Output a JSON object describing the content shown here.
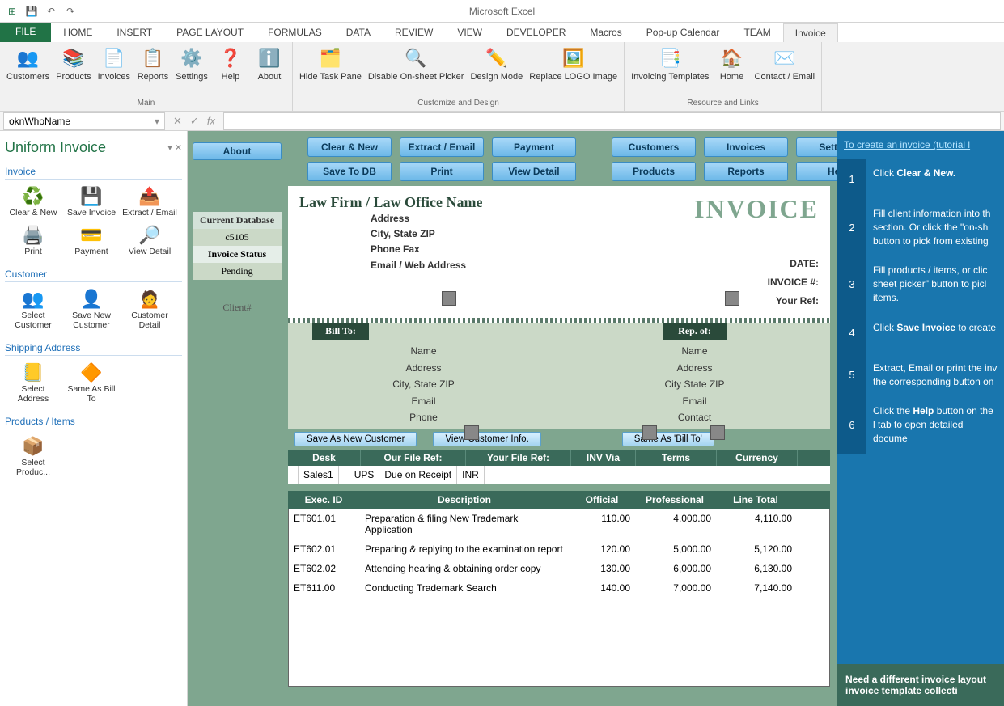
{
  "app_title": "Microsoft Excel",
  "tabs": [
    "FILE",
    "HOME",
    "INSERT",
    "PAGE LAYOUT",
    "FORMULAS",
    "DATA",
    "REVIEW",
    "VIEW",
    "DEVELOPER",
    "Macros",
    "Pop-up Calendar",
    "TEAM",
    "Invoice"
  ],
  "ribbon": {
    "groups": [
      {
        "label": "Main",
        "items": [
          "Customers",
          "Products",
          "Invoices",
          "Reports",
          "Settings",
          "Help",
          "About"
        ]
      },
      {
        "label": "Customize and Design",
        "items": [
          "Hide Task Pane",
          "Disable On-sheet Picker",
          "Design Mode",
          "Replace LOGO Image"
        ]
      },
      {
        "label": "Resource and Links",
        "items": [
          "Invoicing Templates",
          "Home",
          "Contact / Email"
        ]
      }
    ]
  },
  "namebox": "oknWhoName",
  "taskpane": {
    "title": "Uniform Invoice",
    "sections": {
      "invoice": {
        "h": "Invoice",
        "items": [
          "Clear & New",
          "Save Invoice",
          "Extract / Email",
          "Print",
          "Payment",
          "View Detail"
        ]
      },
      "customer": {
        "h": "Customer",
        "items": [
          "Select Customer",
          "Save New Customer",
          "Customer Detail"
        ]
      },
      "shipping": {
        "h": "Shipping Address",
        "items": [
          "Select Address",
          "Same As Bill To"
        ]
      },
      "products": {
        "h": "Products / Items",
        "items": [
          "Select Produc..."
        ]
      }
    }
  },
  "topbuttons": {
    "about": "About",
    "col1": [
      "Clear & New",
      "Save To DB"
    ],
    "col2": [
      "Extract / Email",
      "Print"
    ],
    "col3": [
      "Payment",
      "View Detail"
    ],
    "col4": [
      "Customers",
      "Products"
    ],
    "col5": [
      "Invoices",
      "Reports"
    ],
    "col6": [
      "Settings",
      "Help"
    ]
  },
  "leftlabels": {
    "db": "Current Database",
    "dbval": "c5105",
    "status": "Invoice Status",
    "statusval": "Pending",
    "client": "Client#"
  },
  "header": {
    "firm": "Law Firm / Law Office Name",
    "addr": [
      "Address",
      "City, State ZIP",
      "Phone Fax",
      "Email / Web Address"
    ],
    "invoice": "INVOICE",
    "right": [
      "DATE:",
      "INVOICE #:",
      "Your Ref:"
    ]
  },
  "bill": {
    "h1": "Bill To:",
    "h2": "Rep. of:",
    "left": [
      "Name",
      "Address",
      "City, State ZIP",
      "Email",
      "Phone"
    ],
    "right": [
      "Name",
      "Address",
      "City State ZIP",
      "Email",
      "Contact"
    ]
  },
  "actions": [
    "Save As New Customer",
    "View Customer Info.",
    "Same As 'Bill To'"
  ],
  "detail_hdr": [
    "Desk",
    "Our File Ref:",
    "Your File Ref:",
    "INV Via",
    "Terms",
    "Currency"
  ],
  "detail_vals": [
    "",
    "Sales1",
    "",
    "UPS",
    "Due on Receipt",
    "INR"
  ],
  "items_hdr": [
    "Exec. ID",
    "Description",
    "Official",
    "Professional",
    "Line Total"
  ],
  "items": [
    {
      "id": "ET601.01",
      "desc": "Preparation & filing New Trademark Application",
      "off": "110.00",
      "prof": "4,000.00",
      "tot": "4,110.00"
    },
    {
      "id": "ET602.01",
      "desc": "Preparing & replying to the examination report",
      "off": "120.00",
      "prof": "5,000.00",
      "tot": "5,120.00"
    },
    {
      "id": "ET602.02",
      "desc": "Attending hearing & obtaining order copy",
      "off": "130.00",
      "prof": "6,000.00",
      "tot": "6,130.00"
    },
    {
      "id": "ET611.00",
      "desc": "Conducting Trademark Search",
      "off": "140.00",
      "prof": "7,000.00",
      "tot": "7,140.00"
    }
  ],
  "tutorial": {
    "link": "To create an invoice (tutorial l",
    "steps": [
      {
        "n": "1",
        "t": "Click <b>Clear & New.</b>"
      },
      {
        "n": "2",
        "t": "Fill client information into th section. Or click the \"on-sh button to pick from existing"
      },
      {
        "n": "3",
        "t": "Fill products / items, or clic sheet picker\" button to picl items."
      },
      {
        "n": "4",
        "t": "Click <b>Save Invoice</b> to create"
      },
      {
        "n": "5",
        "t": "Extract, Email or print the inv the corresponding button on"
      },
      {
        "n": "6",
        "t": "Click the <b>Help</b> button on the l tab to open detailed docume"
      }
    ],
    "footer": "Need a different invoice layout invoice template collecti"
  }
}
